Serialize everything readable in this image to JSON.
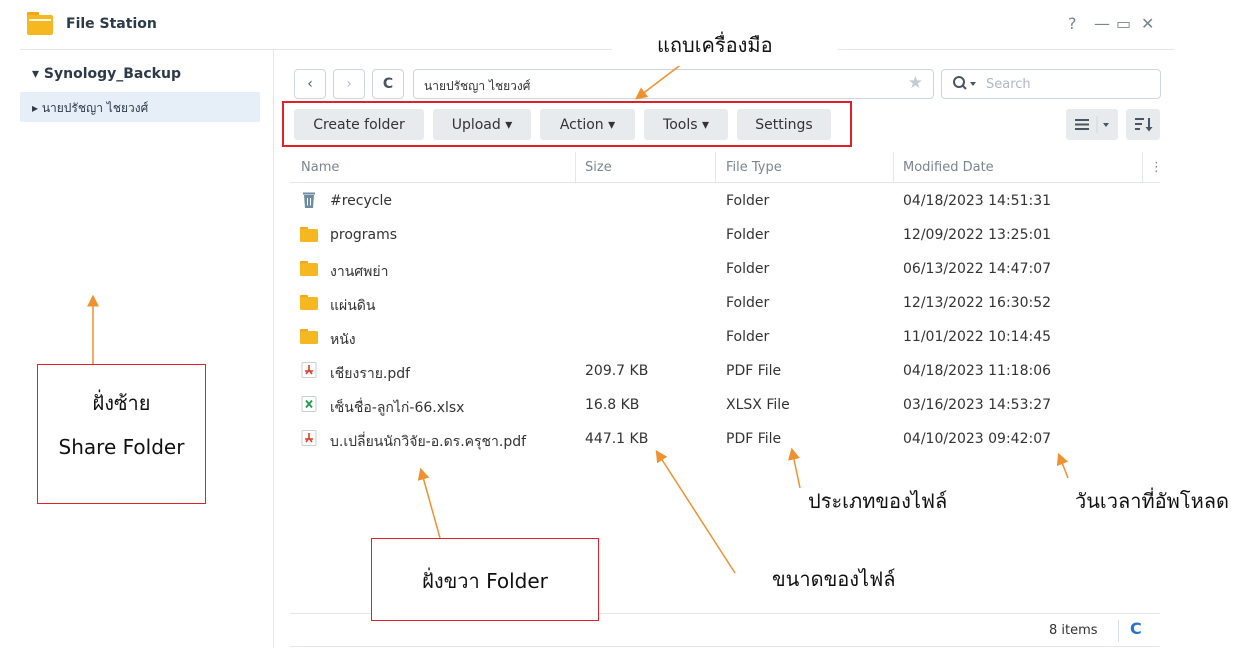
{
  "window": {
    "title": "File Station",
    "help": "?",
    "minimize": "—",
    "maximize": "▭",
    "close": "✕"
  },
  "sidebar": {
    "root": "▾ Synology_Backup",
    "child": "▸ นายปรัชญา ไชยวงศ์"
  },
  "nav": {
    "back": "‹",
    "forward": "›",
    "refresh": "C",
    "path": "นายปรัชญา ไชยวงศ์",
    "star": "★",
    "search_placeholder": "Search"
  },
  "toolbar": {
    "create_folder": "Create folder",
    "upload": "Upload ▾",
    "action": "Action ▾",
    "tools": "Tools ▾",
    "settings": "Settings"
  },
  "columns": {
    "name": "Name",
    "size": "Size",
    "type": "File Type",
    "modified": "Modified Date"
  },
  "files": [
    {
      "icon": "recycle-bin-icon",
      "name": "#recycle",
      "size": "",
      "type": "Folder",
      "modified": "04/18/2023 14:51:31"
    },
    {
      "icon": "folder-icon",
      "name": "programs",
      "size": "",
      "type": "Folder",
      "modified": "12/09/2022 13:25:01"
    },
    {
      "icon": "folder-icon",
      "name": "งานศพย่า",
      "size": "",
      "type": "Folder",
      "modified": "06/13/2022 14:47:07"
    },
    {
      "icon": "folder-icon",
      "name": "แผ่นดิน",
      "size": "",
      "type": "Folder",
      "modified": "12/13/2022 16:30:52"
    },
    {
      "icon": "folder-icon",
      "name": "หนัง",
      "size": "",
      "type": "Folder",
      "modified": "11/01/2022 10:14:45"
    },
    {
      "icon": "pdf-icon",
      "name": "เชียงราย.pdf",
      "size": "209.7 KB",
      "type": "PDF File",
      "modified": "04/18/2023 11:18:06"
    },
    {
      "icon": "xlsx-icon",
      "name": "เซ็นชื่อ-ลูกไก่-66.xlsx",
      "size": "16.8 KB",
      "type": "XLSX File",
      "modified": "03/16/2023 14:53:27"
    },
    {
      "icon": "pdf-icon",
      "name": "บ.เปลี่ยนนักวิจัย-อ.ดร.ครุชา.pdf",
      "size": "447.1 KB",
      "type": "PDF File",
      "modified": "04/10/2023 09:42:07"
    }
  ],
  "footer": {
    "count": "8 items",
    "refresh": "C"
  },
  "annotations": {
    "toolbar": "แถบเครื่องมือ",
    "left_line1": "ฝั่งซ้าย",
    "left_line2": "Share Folder",
    "right_folder": "ฝั่งขวา Folder",
    "file_size": "ขนาดของไฟล์",
    "file_type": "ประเภทของไฟล์",
    "upload_time": "วันเวลาที่อัพโหลด"
  },
  "colors": {
    "accent": "#2a73cc",
    "annotation": "#e0202a",
    "arrow": "#f0912f",
    "folder": "#f6b821"
  }
}
